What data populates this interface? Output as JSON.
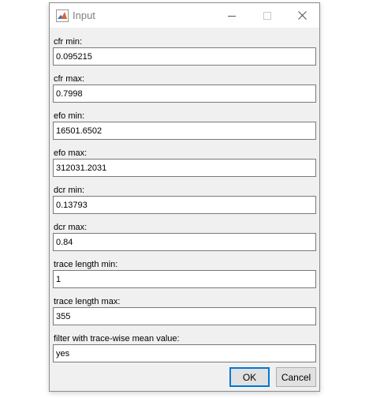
{
  "window": {
    "title": "Input",
    "icon": "matlab-icon"
  },
  "titlebar_buttons": {
    "minimize": "minimize-icon",
    "maximize": "maximize-icon",
    "close": "close-icon"
  },
  "fields": [
    {
      "label": "cfr min:",
      "value": "0.095215"
    },
    {
      "label": "cfr max:",
      "value": "0.7998"
    },
    {
      "label": "efo min:",
      "value": "16501.6502"
    },
    {
      "label": "efo max:",
      "value": "312031.2031"
    },
    {
      "label": "dcr min:",
      "value": "0.13793"
    },
    {
      "label": "dcr max:",
      "value": "0.84"
    },
    {
      "label": "trace length min:",
      "value": "1"
    },
    {
      "label": "trace length max:",
      "value": "355"
    },
    {
      "label": "filter with trace-wise mean value:",
      "value": "yes"
    }
  ],
  "buttons": {
    "ok": "OK",
    "cancel": "Cancel"
  },
  "colors": {
    "focus_border": "#0078d7",
    "dialog_bg": "#f0f0f0"
  }
}
